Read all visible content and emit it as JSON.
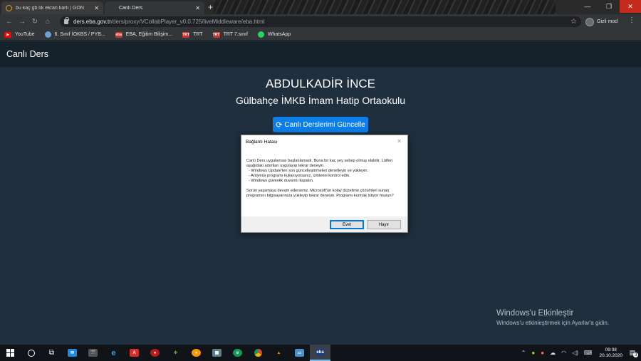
{
  "browser": {
    "tabs": [
      {
        "title": "bu kaç gb lık ekran kartı | GON",
        "active": false
      },
      {
        "title": "Canlı Ders",
        "active": true
      }
    ],
    "new_tab": "+",
    "url_host": "ders.eba.gov.tr",
    "url_path": "/ders/proxy/VCollabPlayer_v0.0.725/liveMiddleware/eba.html",
    "profile_label": "Gizli mod",
    "bookmarks": [
      {
        "label": "YouTube",
        "color": "#ff0000"
      },
      {
        "label": "6. Sınıf İOKBS / PYB...",
        "color": "#6aa0d8"
      },
      {
        "label": "EBA, Eğitim Bilişim...",
        "color": "#c0392b"
      },
      {
        "label": "TRT",
        "color": "#d62c2c"
      },
      {
        "label": "TRT 7.sınıf",
        "color": "#d62c2c"
      },
      {
        "label": "WhatsApp",
        "color": "#25d366"
      }
    ]
  },
  "page": {
    "header_title": "Canlı Ders",
    "student_name": "ABDULKADİR İNCE",
    "school_name": "Gülbahçe İMKB İmam Hatip Ortaokulu",
    "refresh_button": "Canlı Derslerimi Güncelle"
  },
  "dialog": {
    "title": "Bağlantı Hatası",
    "intro": "Canlı Ders uygulaması başlatılamadı. Buna bir kaç şey sebep olmuş olabilir. Lütfen aşağıdaki adımları uygulayıp tekrar deneyin.",
    "steps": [
      "- Windows Update'ten son güncelleştirmeleri denetleyin ve yükleyin.",
      "- Antivirüs programı kullanıyorsanız, izinlerini kontrol edin.",
      "- Windows güvenlik duvarını kapatın."
    ],
    "outro": "Sorun yaşamaya devam ederseniz, Microsoft'un kolay düzeltme çözümleri sunan programını bilgisayarınıza yükleyip tekrar deneyin. Programı kurmak istiyor musun?",
    "yes_label": "Evet",
    "no_label": "Hayır"
  },
  "watermark": {
    "line1": "Windows'u Etkinleştir",
    "line2": "Windows'u etkinleştirmek için Ayarlar'a gidin."
  },
  "taskbar": {
    "time": "09:08",
    "date": "20.10.2020",
    "notification_count": "3"
  }
}
